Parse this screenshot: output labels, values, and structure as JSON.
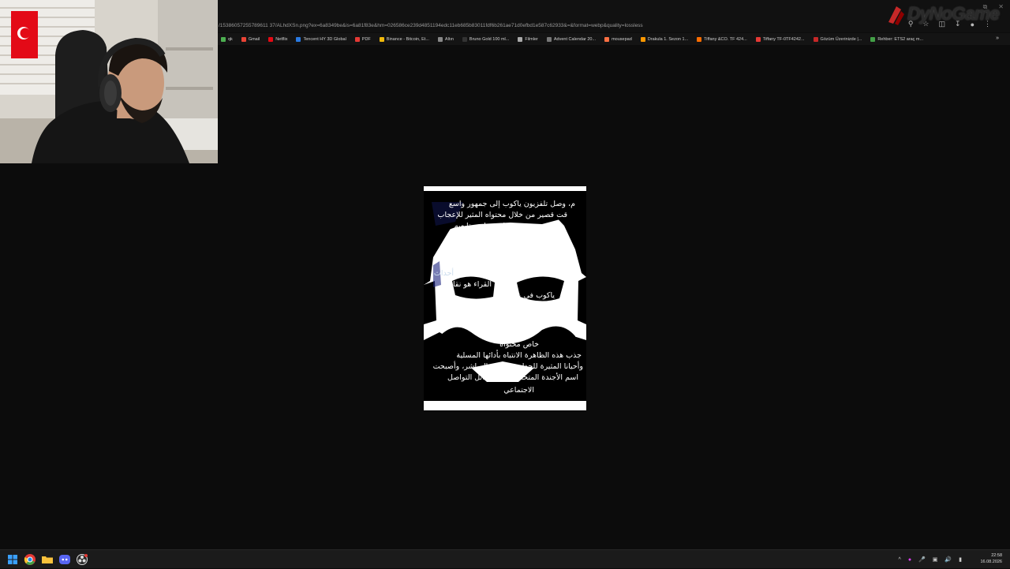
{
  "browser": {
    "url": "/15386057255789611 37/ALhdXSn.png?ex=6a8349be&is=6a81f83e&hm=026586ce239d4851194edc11eb685b83011fdf6b261ae71d0efbd1e587c62933&=&format=webp&quality=lossless",
    "bookmarks": [
      {
        "label": "qk",
        "color": "#4caf50"
      },
      {
        "label": "Gmail",
        "color": "#ea4335"
      },
      {
        "label": "Netflix",
        "color": "#e50914"
      },
      {
        "label": "Tencent HY 3D Global",
        "color": "#2a7ae2"
      },
      {
        "label": "PDF",
        "color": "#e53935"
      },
      {
        "label": "Binance - Bitcoin, Et...",
        "color": "#f0b90b"
      },
      {
        "label": "Altın",
        "color": "#888888"
      },
      {
        "label": "Bruno Gold 100 ml...",
        "color": "#333333"
      },
      {
        "label": "Filmler",
        "color": "#aaaaaa"
      },
      {
        "label": "Advent Calendar 20...",
        "color": "#777777"
      },
      {
        "label": "mousepad",
        "color": "#ff7043"
      },
      {
        "label": "Drakula 1. Sezon 1...",
        "color": "#ff9800"
      },
      {
        "label": "Tiffany &CO. TF 424...",
        "color": "#ff6d00"
      },
      {
        "label": "Tiffany TF-0TF4242...",
        "color": "#e53935"
      },
      {
        "label": "Gözüm Üzerinizde |...",
        "color": "#c62828"
      },
      {
        "label": "Rehber: ETS2 araç m...",
        "color": "#43a047"
      }
    ],
    "more_label": "»"
  },
  "overlay": {
    "logo_text": "DyNoGame"
  },
  "image": {
    "lines": [
      "م، وصل تلفزيون ياكوب إلى جمهور واسع",
      "قت قصير من خلال محتواه المثير للإعجاب",
      "تذهل. يسلي متابعيه",
      "أحداث",
      "القراء هو نقا",
      "ياكوب في على وسا",
      "خاص محتواه",
      "جذب هذه الظاهرة الانتباه بأدائها المسلية",
      "وأحيانا المثيرة للجدل في البث المباشر، وأصبحت",
      "اسم الأجندة المتحدث على وسائل التواصل",
      "الاجتماعي"
    ]
  },
  "taskbar": {
    "apps": [
      "start",
      "chrome",
      "file-explorer",
      "discord",
      "obs"
    ],
    "time": "22:58",
    "date": "16.08.2026",
    "tray_chevron": "^"
  }
}
